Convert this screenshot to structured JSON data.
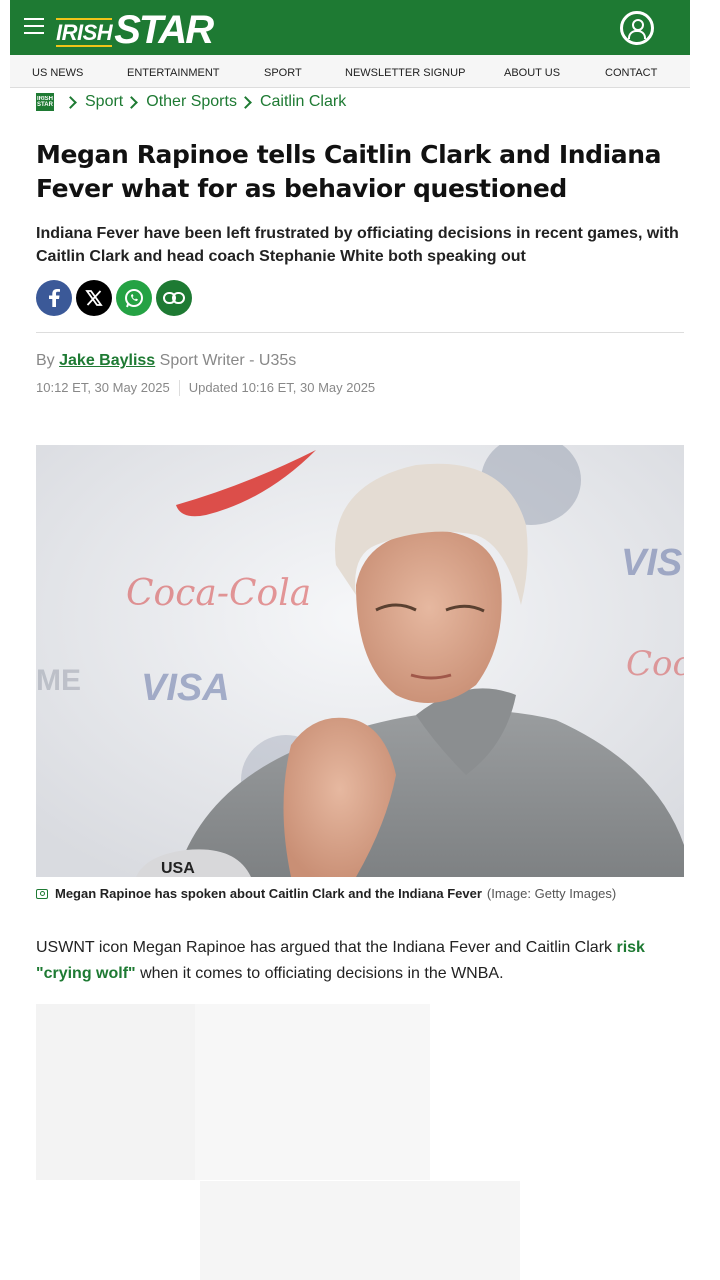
{
  "header": {
    "logo_top": "IRISH",
    "logo_bottom": "STAR",
    "brand_color": "#1e7a33"
  },
  "nav": {
    "items": [
      "US NEWS",
      "ENTERTAINMENT",
      "SPORT",
      "NEWSLETTER SIGNUP",
      "ABOUT US",
      "CONTACT"
    ]
  },
  "breadcrumb": {
    "logo_text": "IRISH STAR",
    "items": [
      "Sport",
      "Other Sports",
      "Caitlin Clark"
    ]
  },
  "article": {
    "headline": "Megan Rapinoe tells Caitlin Clark and Indiana Fever what for as behavior questioned",
    "standfirst": "Indiana Fever have been left frustrated by officiating decisions in recent games, with Caitlin Clark and head coach Stephanie White both speaking out",
    "byline_prefix": "By",
    "author": "Jake Bayliss",
    "author_role": "Sport Writer - U35s",
    "published": "10:12 ET, 30 May 2025",
    "updated": "Updated 10:16 ET, 30 May 2025",
    "caption": "Megan Rapinoe has spoken about Caitlin Clark and the Indiana Fever",
    "caption_credit": "(Image: Getty Images)",
    "paragraph_before": "USWNT icon Megan Rapinoe has argued that the Indiana Fever and Caitlin Clark",
    "paragraph_link": "risk \"crying wolf\"",
    "paragraph_after": "when it comes to officiating decisions in the WNBA."
  },
  "share": {
    "facebook_color": "#3b5998",
    "x_color": "#000000",
    "whatsapp_color": "#25a244",
    "link_color": "#1e7a33"
  }
}
